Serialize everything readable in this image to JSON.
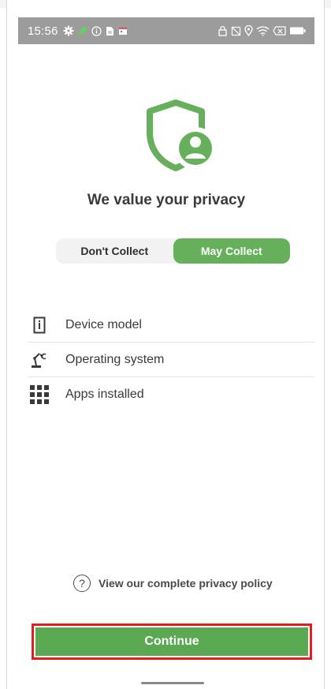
{
  "status_bar": {
    "time": "15:56"
  },
  "colors": {
    "accent": "#66b05c",
    "highlight_border": "#e01e1e"
  },
  "privacy": {
    "title": "We value your privacy",
    "toggle": {
      "options": [
        "Don't Collect",
        "May Collect"
      ],
      "selected": "May Collect"
    },
    "items": [
      {
        "label": "Device model",
        "icon": "device-icon"
      },
      {
        "label": "Operating system",
        "icon": "os-icon"
      },
      {
        "label": "Apps installed",
        "icon": "apps-grid-icon"
      }
    ],
    "policy_link": "View our complete privacy policy",
    "continue_label": "Continue"
  }
}
